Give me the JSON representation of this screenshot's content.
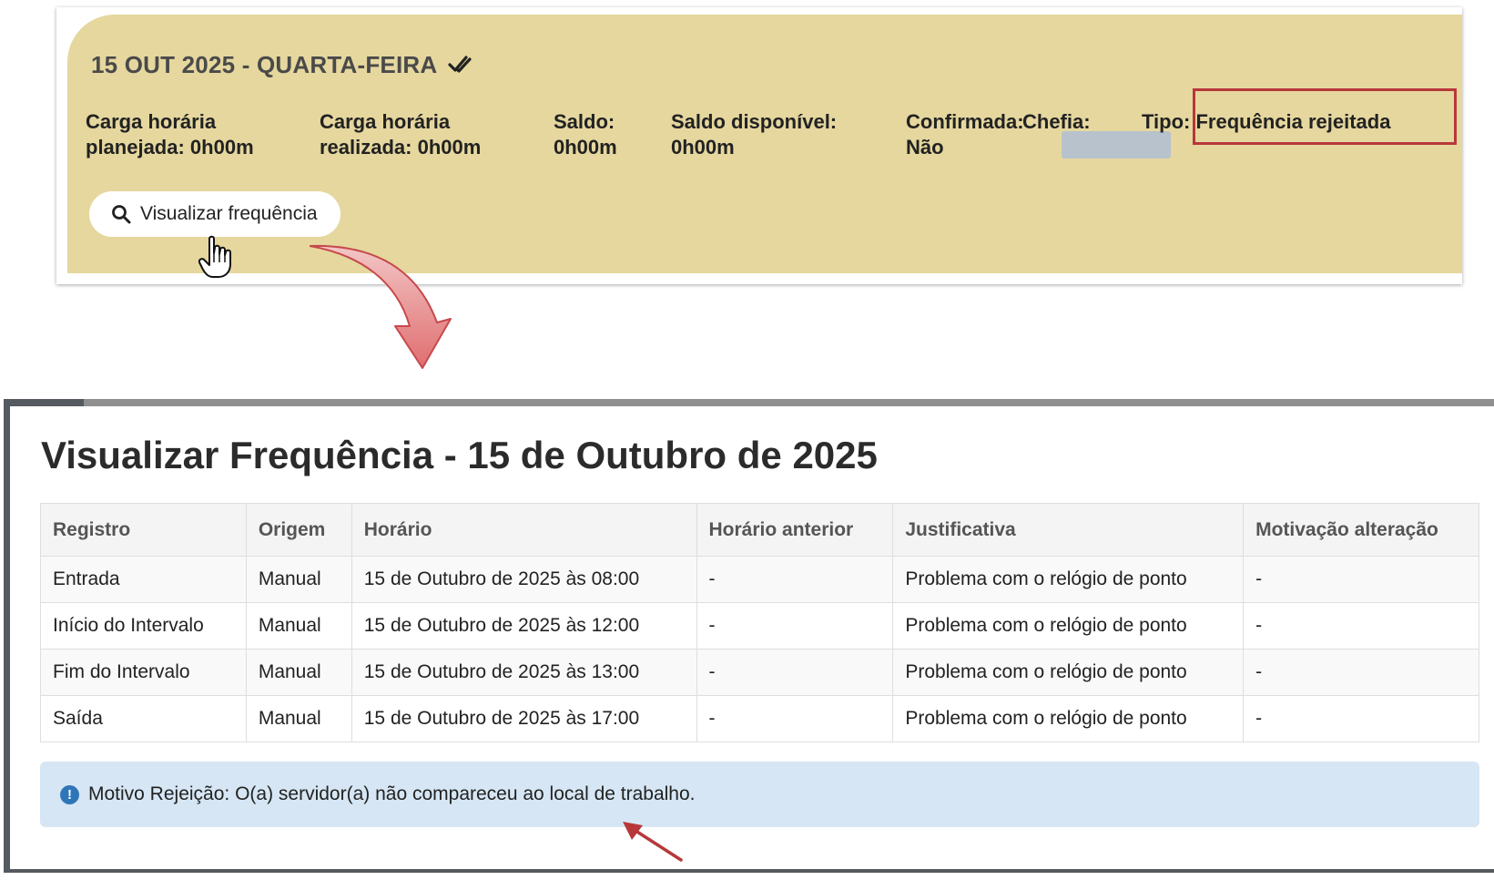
{
  "card": {
    "date_title": "15 OUT 2025 - QUARTA-FEIRA",
    "status_icon": "double-check-icon",
    "background_color": "#e5d79e",
    "fields": {
      "planned_label": "Carga horária",
      "planned_value": "planejada: 0h00m",
      "realized_label": "Carga horária",
      "realized_value": "realizada: 0h00m",
      "saldo_label": "Saldo:",
      "saldo_value": "0h00m",
      "saldo_disp_label": "Saldo disponível:",
      "saldo_disp_value": "0h00m",
      "confirmada_label": "Confirmada:",
      "confirmada_value": "Não",
      "chefia_label": "Chefia:",
      "tipo_text": "Tipo: Frequência rejeitada"
    },
    "highlight_color": "#b7383a",
    "view_button_label": "Visualizar frequência",
    "view_button_icon": "search-icon"
  },
  "dialog": {
    "title": "Visualizar Frequência - 15 de Outubro de 2025",
    "table": {
      "headers": [
        "Registro",
        "Origem",
        "Horário",
        "Horário anterior",
        "Justificativa",
        "Motivação alteração"
      ],
      "rows": [
        [
          "Entrada",
          "Manual",
          "15 de Outubro de 2025 às 08:00",
          "-",
          "Problema com o relógio de ponto",
          "-"
        ],
        [
          "Início do Intervalo",
          "Manual",
          "15 de Outubro de 2025 às 12:00",
          "-",
          "Problema com o relógio de ponto",
          "-"
        ],
        [
          "Fim do Intervalo",
          "Manual",
          "15 de Outubro de 2025 às 13:00",
          "-",
          "Problema com o relógio de ponto",
          "-"
        ],
        [
          "Saída",
          "Manual",
          "15 de Outubro de 2025 às 17:00",
          "-",
          "Problema com o relógio de ponto",
          "-"
        ]
      ]
    },
    "alert": {
      "icon": "info-icon",
      "text": "Motivo Rejeição: O(a) servidor(a) não compareceu ao local de trabalho.",
      "background_color": "#d6e6f4"
    }
  }
}
